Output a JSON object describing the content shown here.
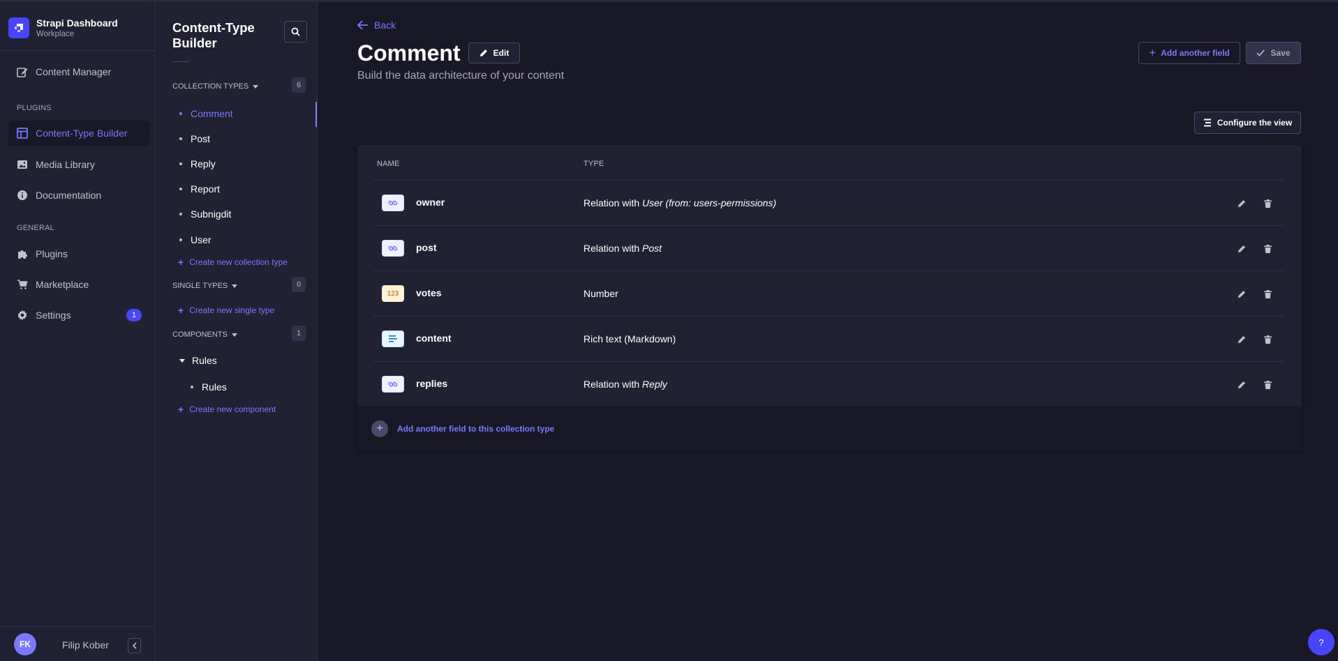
{
  "brand": {
    "title": "Strapi Dashboard",
    "subtitle": "Workplace"
  },
  "mainnav": {
    "content_manager": "Content Manager",
    "plugins_title": "PLUGINS",
    "content_type_builder": "Content-Type Builder",
    "media_library": "Media Library",
    "documentation": "Documentation",
    "general_title": "GENERAL",
    "plugins": "Plugins",
    "marketplace": "Marketplace",
    "settings": "Settings",
    "settings_badge": "1"
  },
  "user": {
    "initials": "FK",
    "name": "Filip Kober"
  },
  "subnav": {
    "title": "Content-Type Builder",
    "collection_types": {
      "label": "COLLECTION TYPES",
      "count": "6",
      "items": [
        "Comment",
        "Post",
        "Reply",
        "Report",
        "Subnigdit",
        "User"
      ],
      "create": "Create new collection type"
    },
    "single_types": {
      "label": "SINGLE TYPES",
      "count": "0",
      "create": "Create new single type"
    },
    "components": {
      "label": "COMPONENTS",
      "count": "1",
      "category": "Rules",
      "items": [
        "Rules"
      ],
      "create": "Create new component"
    }
  },
  "header": {
    "back": "Back",
    "title": "Comment",
    "edit": "Edit",
    "subtitle": "Build the data architecture of your content",
    "add_field": "Add another field",
    "save": "Save",
    "configure": "Configure the view"
  },
  "table": {
    "col_name": "NAME",
    "col_type": "TYPE",
    "rows": [
      {
        "icon": "relation",
        "name": "owner",
        "type_prefix": "Relation with ",
        "type_italic": "User (from: users-permissions)"
      },
      {
        "icon": "relation",
        "name": "post",
        "type_prefix": "Relation with ",
        "type_italic": "Post"
      },
      {
        "icon": "number",
        "icon_text": "123",
        "name": "votes",
        "type_prefix": "Number",
        "type_italic": ""
      },
      {
        "icon": "richtext",
        "name": "content",
        "type_prefix": "Rich text (Markdown)",
        "type_italic": ""
      },
      {
        "icon": "relation",
        "name": "replies",
        "type_prefix": "Relation with ",
        "type_italic": "Reply"
      }
    ],
    "footer_add": "Add another field to this collection type"
  },
  "help": "?",
  "colors": {
    "accent": "#7b79ff",
    "brand": "#4945ff",
    "background": "#181826",
    "panel": "#212134"
  }
}
